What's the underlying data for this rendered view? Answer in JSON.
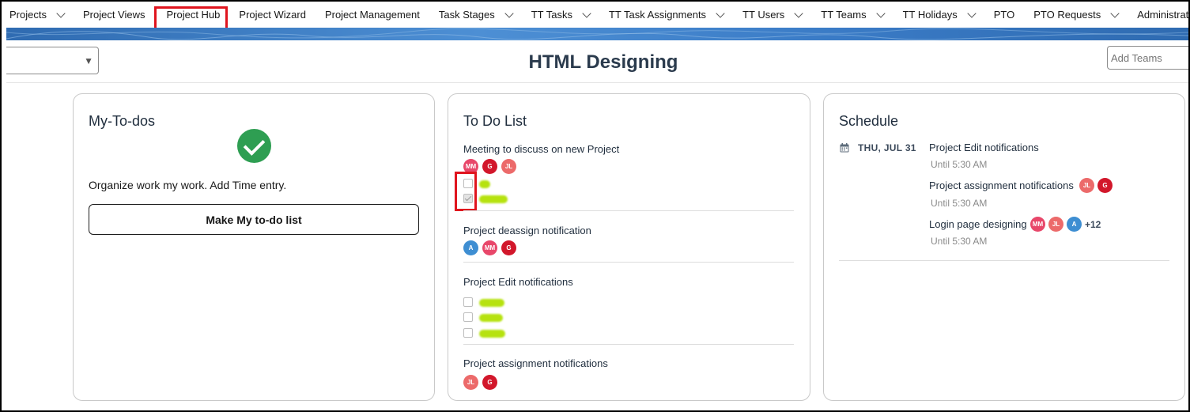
{
  "nav": {
    "items": [
      {
        "label": "Projects",
        "chevron": true
      },
      {
        "label": "Project Views",
        "chevron": false
      },
      {
        "label": "Project Hub",
        "chevron": false
      },
      {
        "label": "Project Wizard",
        "chevron": false
      },
      {
        "label": "Project Management",
        "chevron": false
      },
      {
        "label": "Task Stages",
        "chevron": true
      },
      {
        "label": "TT Tasks",
        "chevron": true
      },
      {
        "label": "TT Task Assignments",
        "chevron": true
      },
      {
        "label": "TT Users",
        "chevron": true
      },
      {
        "label": "TT Teams",
        "chevron": true
      },
      {
        "label": "TT Holidays",
        "chevron": true
      },
      {
        "label": "PTO",
        "chevron": false
      },
      {
        "label": "PTO Requests",
        "chevron": true
      },
      {
        "label": "Administrative",
        "chevron": false
      }
    ]
  },
  "header": {
    "title": "HTML Designing",
    "add_teams_placeholder": "Add Teams"
  },
  "my_todos": {
    "title": "My-To-dos",
    "description": "Organize work my work. Add Time entry.",
    "button_label": "Make My to-do list"
  },
  "todo_list": {
    "title": "To Do List",
    "tasks": [
      {
        "title": "Meeting to discuss on new Project",
        "avatars": [
          "MM",
          "G",
          "JL"
        ]
      },
      {
        "title": "Project deassign notification",
        "avatars": [
          "A",
          "MM",
          "G"
        ]
      },
      {
        "title": "Project Edit notifications",
        "avatars": []
      },
      {
        "title": "Project assignment notifications",
        "avatars": [
          "JL",
          "G"
        ]
      }
    ]
  },
  "schedule": {
    "title": "Schedule",
    "date": "THU, JUL 31",
    "events": [
      {
        "title": "Project Edit notifications",
        "time": "Until 5:30 AM",
        "avatars": []
      },
      {
        "title": "Project assignment notifications",
        "time": "Until 5:30 AM",
        "avatars": [
          "JL",
          "G"
        ]
      },
      {
        "title": "Login page designing",
        "time": "Until 5:30 AM",
        "avatars": [
          "MM",
          "JL",
          "A"
        ],
        "more": "+12"
      }
    ]
  },
  "colors": {
    "accent_green": "#2e9e52",
    "highlight_red": "#e0141e",
    "banner_blue": "#3a7bc6"
  }
}
